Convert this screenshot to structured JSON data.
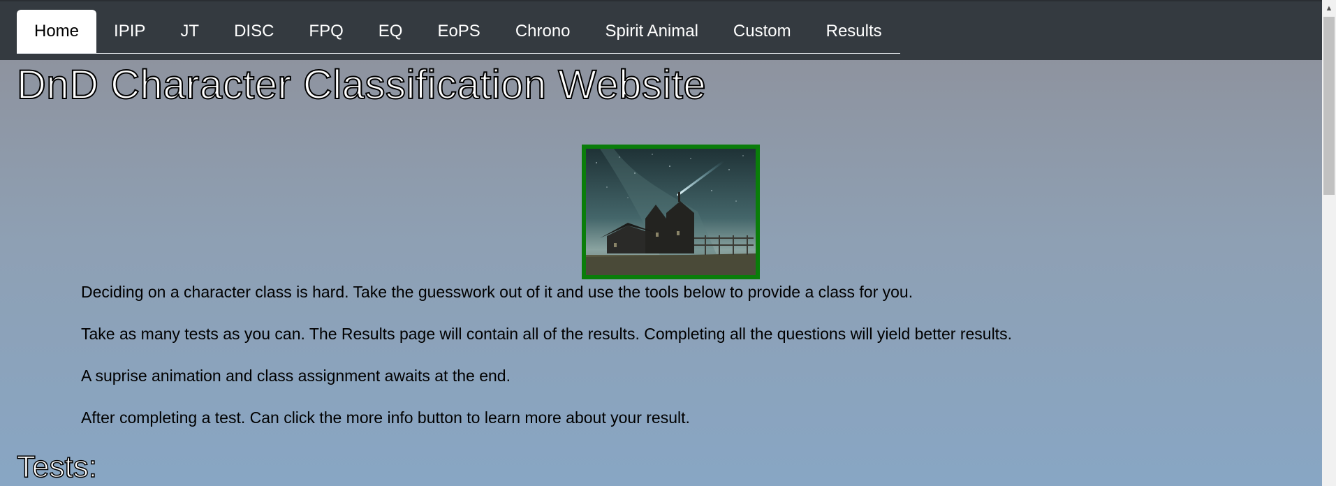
{
  "nav": {
    "tabs": [
      {
        "label": "Home",
        "active": true
      },
      {
        "label": "IPIP"
      },
      {
        "label": "JT"
      },
      {
        "label": "DISC"
      },
      {
        "label": "FPQ"
      },
      {
        "label": "EQ"
      },
      {
        "label": "EoPS"
      },
      {
        "label": "Chrono"
      },
      {
        "label": "Spirit Animal"
      },
      {
        "label": "Custom"
      },
      {
        "label": "Results"
      }
    ]
  },
  "main": {
    "title": "DnD Character Classification Website",
    "paragraphs": [
      "Deciding on a character class is hard. Take the guesswork out of it and use the tools below to provide a class for you.",
      "Take as many tests as you can. The Results page will contain all of the results. Completing all the questions will yield better results.",
      "A suprise animation and class assignment awaits at the end.",
      "After completing a test. Can click the more info button to learn more about your result."
    ],
    "tests_heading": "Tests:"
  },
  "colors": {
    "nav_bg": "#343a40",
    "image_border": "#0a7d0a"
  }
}
